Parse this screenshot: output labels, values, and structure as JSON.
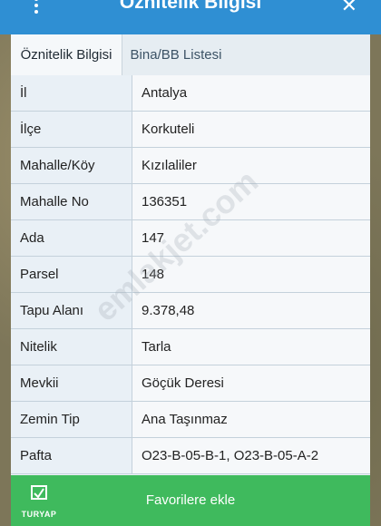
{
  "window": {
    "title": "Öznitelik Bilgisi",
    "close_icon": "close-icon",
    "menu_icon": "kebab-menu-icon"
  },
  "tabs": [
    {
      "label": "Öznitelik Bilgisi",
      "active": true
    },
    {
      "label": "Bina/BB Listesi",
      "active": false
    }
  ],
  "attributes": [
    {
      "label": "İl",
      "value": "Antalya"
    },
    {
      "label": "İlçe",
      "value": "Korkuteli"
    },
    {
      "label": "Mahalle/Köy",
      "value": "Kızılaliler"
    },
    {
      "label": "Mahalle No",
      "value": "136351"
    },
    {
      "label": "Ada",
      "value": "147"
    },
    {
      "label": "Parsel",
      "value": "148"
    },
    {
      "label": "Tapu Alanı",
      "value": "9.378,48"
    },
    {
      "label": "Nitelik",
      "value": "Tarla"
    },
    {
      "label": "Mevkii",
      "value": "Göçük Deresi"
    },
    {
      "label": "Zemin Tip",
      "value": "Ana Taşınmaz"
    },
    {
      "label": "Pafta",
      "value": "O23-B-05-B-1, O23-B-05-A-2"
    }
  ],
  "footer": {
    "button_label": "Favorilere ekle",
    "logo_text": "TURYAP"
  },
  "watermark": "emlakjet.com",
  "colors": {
    "header": "#2f8fd3",
    "footer": "#3fba5d"
  }
}
